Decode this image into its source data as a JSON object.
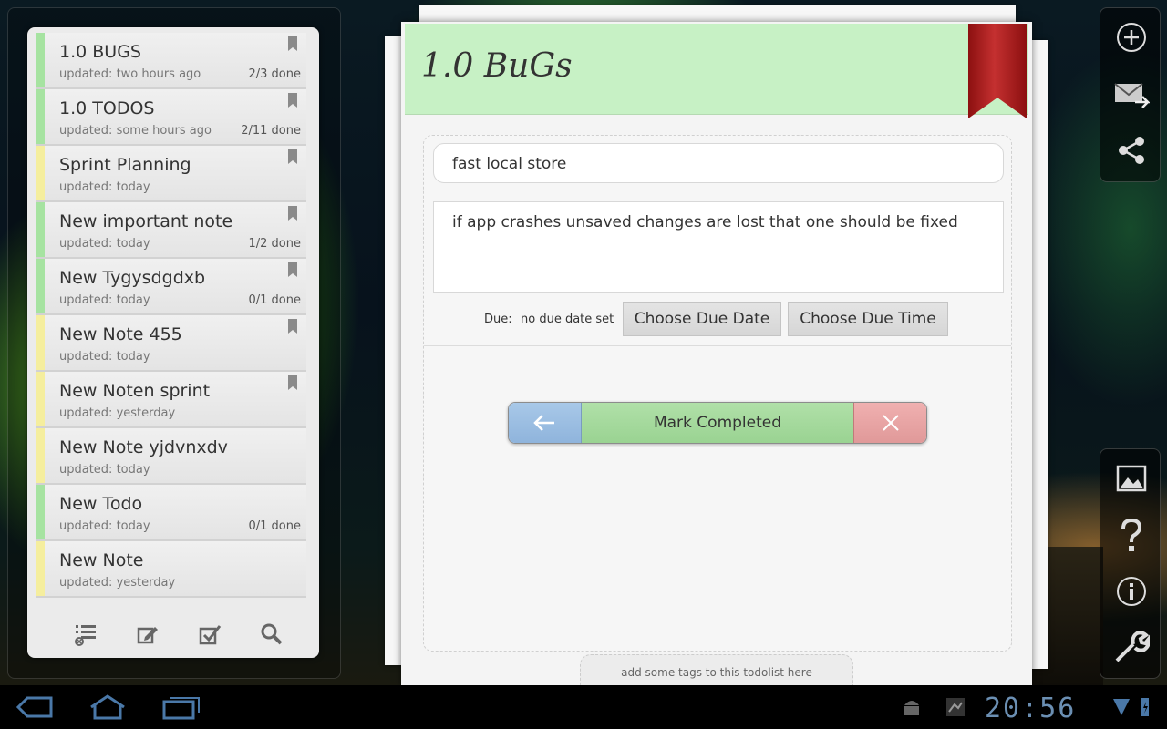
{
  "notes": [
    {
      "title": "1.0 BUGS",
      "updated": "updated: two hours ago",
      "done": "2/3 done",
      "color": "#a6e3a1",
      "bookmarked": true
    },
    {
      "title": "1.0 TODOS",
      "updated": "updated: some hours ago",
      "done": "2/11 done",
      "color": "#a6e3a1",
      "bookmarked": true
    },
    {
      "title": "Sprint Planning",
      "updated": "updated: today",
      "done": "",
      "color": "#f5ee9e",
      "bookmarked": true
    },
    {
      "title": "New important note",
      "updated": "updated: today",
      "done": "1/2 done",
      "color": "#a6e3a1",
      "bookmarked": true
    },
    {
      "title": "New Tygysdgdxb",
      "updated": "updated: today",
      "done": "0/1 done",
      "color": "#a6e3a1",
      "bookmarked": true
    },
    {
      "title": "New Note 455",
      "updated": "updated: today",
      "done": "",
      "color": "#f5ee9e",
      "bookmarked": true
    },
    {
      "title": "New Noten sprint",
      "updated": "updated: yesterday",
      "done": "",
      "color": "#f5ee9e",
      "bookmarked": true
    },
    {
      "title": "New Note yjdvnxdv",
      "updated": "updated: today",
      "done": "",
      "color": "#f5ee9e",
      "bookmarked": false
    },
    {
      "title": "New Todo",
      "updated": "updated: today",
      "done": "0/1 done",
      "color": "#a6e3a1",
      "bookmarked": false
    },
    {
      "title": "New Note",
      "updated": "updated: yesterday",
      "done": "",
      "color": "#f5ee9e",
      "bookmarked": false
    }
  ],
  "list_toolbar": {
    "icons": [
      "list-settings-icon",
      "edit-note-icon",
      "checklist-icon",
      "search-icon"
    ]
  },
  "detail": {
    "title": "1.0 BuGs",
    "task_title": "fast local store",
    "task_description": "if app crashes unsaved changes are lost that one should be fixed",
    "due_label": "Due:",
    "due_value": "no due date set",
    "choose_date_label": "Choose Due Date",
    "choose_time_label": "Choose Due Time",
    "mark_completed_label": "Mark Completed",
    "tags_placeholder": "add some tags to this todolist here",
    "header_color": "#c7f1c5",
    "ribbon_color": "#b02525"
  },
  "side_actions_top": [
    "add-icon",
    "email-icon",
    "share-icon"
  ],
  "side_actions_bottom": [
    "image-icon",
    "help-icon",
    "info-icon",
    "settings-wrench-icon"
  ],
  "system_bar": {
    "clock": "20:56",
    "nav_icons": [
      "back-icon",
      "home-icon",
      "recent-apps-icon"
    ],
    "status_icons": [
      "android-debug-icon",
      "notification-icon",
      "wifi-icon",
      "battery-icon"
    ]
  }
}
